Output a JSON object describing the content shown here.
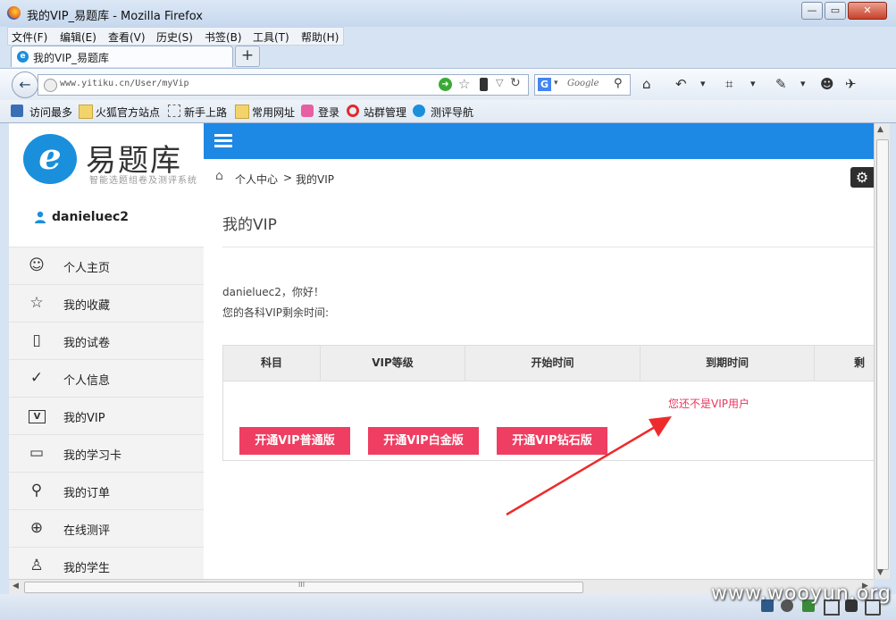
{
  "window": {
    "title": "我的VIP_易题库 - Mozilla Firefox",
    "minimize": "—",
    "maximize": "▭",
    "close": "✕"
  },
  "menubar": {
    "items": [
      "文件(F)",
      "编辑(E)",
      "查看(V)",
      "历史(S)",
      "书签(B)",
      "工具(T)",
      "帮助(H)"
    ]
  },
  "tabs": [
    {
      "label": "我的VIP_易题库",
      "icon": "e"
    }
  ],
  "newtab_label": "+",
  "navbar": {
    "back": "←",
    "url": "www.yitiku.cn/User/myVip",
    "search_engine": "G",
    "search_placeholder": "Google",
    "go": "➜",
    "star": "☆",
    "dropdown": "▽",
    "reload": "↻",
    "search_magnifier": "⚲"
  },
  "toolbar_icons": [
    "⌂",
    "↶",
    "▾",
    "⌗",
    "▾",
    "✎",
    "▾",
    "☻",
    "✈"
  ],
  "bookmarks": [
    "访问最多",
    "火狐官方站点",
    "新手上路",
    "常用网址",
    "登录",
    "站群管理",
    "测评导航"
  ],
  "site": {
    "logo_letter": "e",
    "logo_name": "易题库",
    "logo_tagline": "智能选题组卷及测评系统",
    "username": "danieluec2",
    "nav": [
      {
        "label": "个人主页",
        "icon": "person-icon",
        "glyph": "☺"
      },
      {
        "label": "我的收藏",
        "icon": "star-icon",
        "glyph": "☆"
      },
      {
        "label": "我的试卷",
        "icon": "paper-icon",
        "glyph": "▯"
      },
      {
        "label": "个人信息",
        "icon": "user-check-icon",
        "glyph": "✓"
      },
      {
        "label": "我的VIP",
        "icon": "vip-icon",
        "glyph": "V"
      },
      {
        "label": "我的学习卡",
        "icon": "card-icon",
        "glyph": "▭"
      },
      {
        "label": "我的订单",
        "icon": "search-icon",
        "glyph": "⚲"
      },
      {
        "label": "在线测评",
        "icon": "globe-icon",
        "glyph": "⊕"
      },
      {
        "label": "我的学生",
        "icon": "students-icon",
        "glyph": "♙"
      }
    ],
    "breadcrumb": {
      "home": "⌂",
      "first": "个人中心",
      "sep": ">",
      "second": "我的VIP"
    },
    "gear": "⚙",
    "page_title": "我的VIP",
    "greeting": "danieluec2，你好！",
    "remain_text": "您的各科VIP剩余时间:",
    "table": {
      "headers": [
        "科目",
        "VIP等级",
        "开始时间",
        "到期时间",
        "剩"
      ],
      "empty_message": "您还不是VIP用户"
    },
    "buttons": [
      "开通VIP普通版",
      "开通VIP白金版",
      "开通VIP钻石版"
    ],
    "accent_color": "#1e88e5",
    "button_color": "#ef3e61"
  },
  "scrollbar": {
    "h_grip": "III"
  },
  "watermark": "www.wooyun.org"
}
